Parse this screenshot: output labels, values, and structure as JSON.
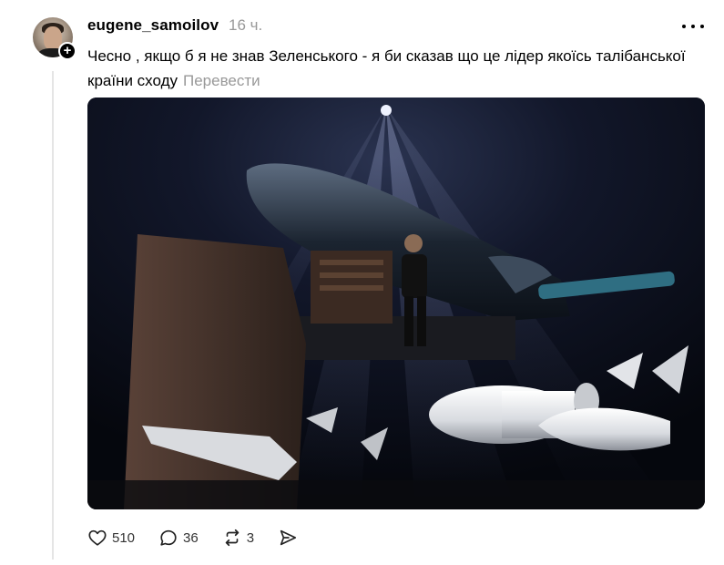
{
  "post": {
    "username": "eugene_samoilov",
    "timestamp": "16 ч.",
    "text": "Чесно , якщо б я не знав Зеленського - я би сказав що це лідер якоїсь талібанської країни сходу",
    "translate_label": "Перевести",
    "follow_badge": "+",
    "avatar_icon": "user-avatar",
    "media_icon": "photo-missile-exhibition"
  },
  "actions": {
    "likes": "510",
    "comments": "36",
    "reposts": "3",
    "like_icon": "heart-icon",
    "comment_icon": "speech-bubble-icon",
    "repost_icon": "repost-arrows-icon",
    "share_icon": "send-arrow-icon"
  },
  "colors": {
    "text": "#000000",
    "muted": "#999999",
    "thread_line": "#e5e5e5",
    "background": "#ffffff"
  }
}
